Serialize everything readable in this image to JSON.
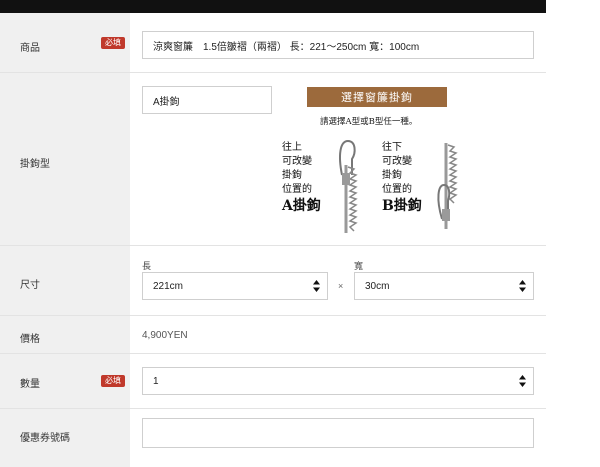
{
  "form": {
    "required_badge": "必填",
    "product": {
      "label": "商品",
      "value": "涼爽窗簾　1.5倍皺褶（兩褶） 長：221～250cm 寬：100cm"
    },
    "hook": {
      "label": "掛鉤型",
      "value": "A掛鉤",
      "title": "選擇窗簾掛鉤",
      "subtitle": "請選擇A型或B型任一種。",
      "type_a": {
        "lines": [
          "往上",
          "可改變",
          "掛鉤",
          "位置的"
        ],
        "name": "A掛鉤"
      },
      "type_b": {
        "lines": [
          "往下",
          "可改變",
          "掛鉤",
          "位置的"
        ],
        "name": "B掛鉤"
      }
    },
    "size": {
      "label": "尺寸",
      "length_label": "長",
      "length_value": "221cm",
      "times": "×",
      "width_label": "寬",
      "width_value": "30cm"
    },
    "price": {
      "label": "價格",
      "value": "4,900YEN"
    },
    "quantity": {
      "label": "數量",
      "value": "1"
    },
    "coupon": {
      "label": "優惠券號碼",
      "value": ""
    }
  },
  "colors": {
    "header_bar": "#111111",
    "label_bg": "#f0f0f0",
    "required_badge": "#c0392b",
    "hook_title_bg": "#9c6a3c"
  },
  "icons": [
    "select-arrows-icon",
    "curtain-hook-a-icon",
    "curtain-hook-b-icon"
  ]
}
